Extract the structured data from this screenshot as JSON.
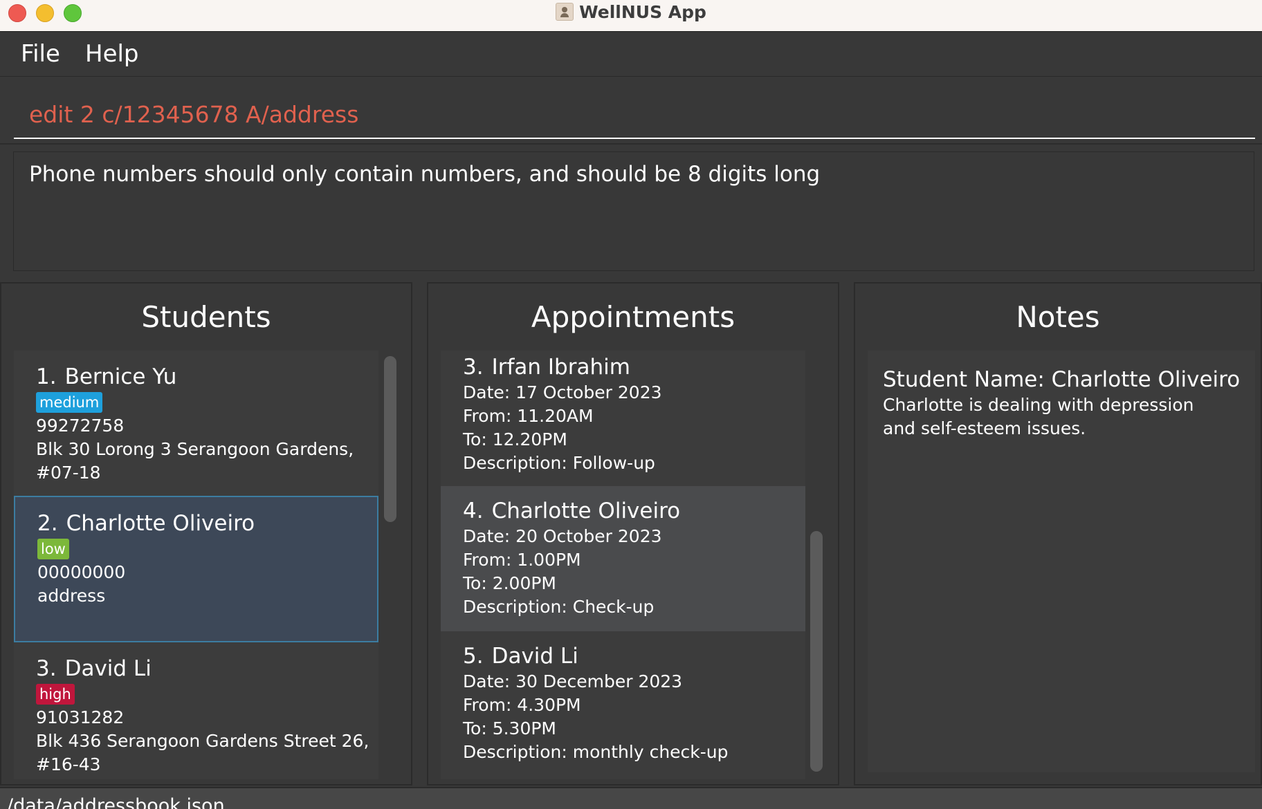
{
  "window": {
    "title": "WellNUS App"
  },
  "menu": {
    "file": "File",
    "help": "Help"
  },
  "command": {
    "value": "edit 2 c/12345678 A/address",
    "color": "#e0614e"
  },
  "result": {
    "message": "Phone numbers should only contain numbers, and should be 8 digits long"
  },
  "students": {
    "title": "Students",
    "items": [
      {
        "index": "1.",
        "name": "Bernice Yu",
        "tag": "medium",
        "tag_color": "#1ea0dc",
        "phone": "99272758",
        "address_line1": "Blk 30 Lorong 3 Serangoon Gardens,",
        "address_line2": "#07-18"
      },
      {
        "index": "2.",
        "name": "Charlotte Oliveiro",
        "tag": "low",
        "tag_color": "#7cb83a",
        "phone": "00000000",
        "address_line1": "address",
        "address_line2": ""
      },
      {
        "index": "3.",
        "name": "David Li",
        "tag": "high",
        "tag_color": "#c0163c",
        "phone": "91031282",
        "address_line1": "Blk 436 Serangoon Gardens Street 26,",
        "address_line2": "#16-43"
      }
    ]
  },
  "appointments": {
    "title": "Appointments",
    "items": [
      {
        "index": "3.",
        "name": "Irfan Ibrahim",
        "date": "Date: 17 October 2023",
        "from": "From: 11.20AM",
        "to": "To: 12.20PM",
        "description": "Description: Follow-up"
      },
      {
        "index": "4.",
        "name": "Charlotte Oliveiro",
        "date": "Date: 20 October 2023",
        "from": "From: 1.00PM",
        "to": "To: 2.00PM",
        "description": "Description: Check-up"
      },
      {
        "index": "5.",
        "name": "David Li",
        "date": "Date: 30 December 2023",
        "from": "From: 4.30PM",
        "to": "To: 5.30PM",
        "description": "Description: monthly check-up"
      }
    ]
  },
  "notes": {
    "title": "Notes",
    "student_name": "Student Name: Charlotte Oliveiro",
    "body": "Charlotte is dealing with depression and self-esteem issues."
  },
  "status": {
    "path": "/data/addressbook.json"
  }
}
